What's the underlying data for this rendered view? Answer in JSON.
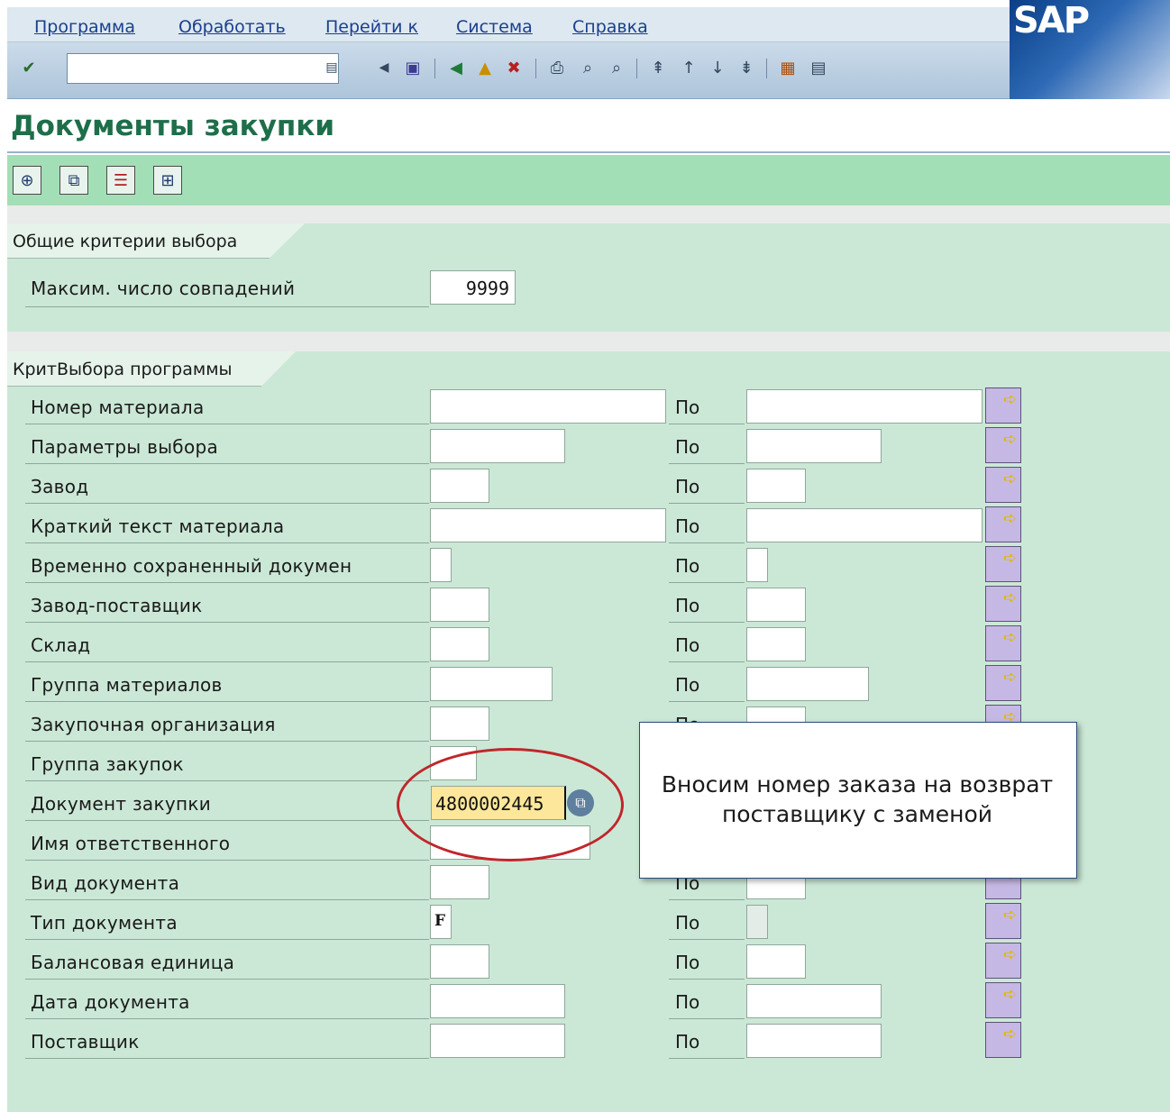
{
  "menu": [
    "Программа",
    "Обработать",
    "Перейти к",
    "Система",
    "Справка"
  ],
  "brand": {
    "logo_text": "SAP"
  },
  "icons": {
    "enter": "enter-check-icon",
    "save": "save-icon",
    "back": "back-icon",
    "exit": "exit-icon",
    "cancel": "cancel-icon",
    "print": "print-icon",
    "find": "find-icon",
    "find_next": "find-next-icon",
    "first_page": "first-page-icon",
    "prev_page": "previous-page-icon",
    "next_page": "next-page-icon",
    "last_page": "last-page-icon",
    "create_session": "create-session-icon",
    "shortcut": "generate-shortcut-icon",
    "execute": "execute-icon",
    "get_variant": "get-variant-icon",
    "selection_options": "selection-options-icon",
    "dynamic_selection": "dynamic-selection-icon",
    "multiple_selection": "multiple-selection-arrow-icon"
  },
  "page": {
    "title": "Документы закупки"
  },
  "general_group": {
    "label": "Общие критерии выбора",
    "max_hits_label": "Максим. число совпадений",
    "max_hits_value": "9999"
  },
  "program_group": {
    "label": "КритВыбора программы",
    "to_label": "По",
    "rows": [
      {
        "label": "Номер материала",
        "from": "",
        "to": ""
      },
      {
        "label": "Параметры выбора",
        "from": "",
        "to": ""
      },
      {
        "label": "Завод",
        "from": "",
        "to": ""
      },
      {
        "label": "Краткий текст материала",
        "from": "",
        "to": ""
      },
      {
        "label": "Временно сохраненный докумен",
        "from": "",
        "to": ""
      },
      {
        "label": "Завод-поставщик",
        "from": "",
        "to": ""
      },
      {
        "label": "Склад",
        "from": "",
        "to": ""
      },
      {
        "label": "Группа материалов",
        "from": "",
        "to": ""
      },
      {
        "label": "Закупочная организация",
        "from": "",
        "to": ""
      },
      {
        "label": "Группа закупок",
        "from": "",
        "to": ""
      },
      {
        "label": "Документ закупки",
        "from": "4800002445",
        "to": ""
      },
      {
        "label": "Имя ответственного",
        "from": "",
        "to": ""
      },
      {
        "label": "Вид документа",
        "from": "",
        "to": ""
      },
      {
        "label": "Тип документа",
        "from": "F",
        "to": ""
      },
      {
        "label": "Балансовая единица",
        "from": "",
        "to": ""
      },
      {
        "label": "Дата документа",
        "from": "",
        "to": ""
      },
      {
        "label": "Поставщик",
        "from": "",
        "to": ""
      }
    ]
  },
  "callout": {
    "text": "Вносим номер заказа на возврат поставщику с заменой"
  },
  "colors": {
    "title": "#1e6e4a",
    "app_toolbar": "#a3dfb6",
    "group_bg": "#cbe8d6",
    "highlight": "#fde79a",
    "annotation": "#c0262b"
  }
}
